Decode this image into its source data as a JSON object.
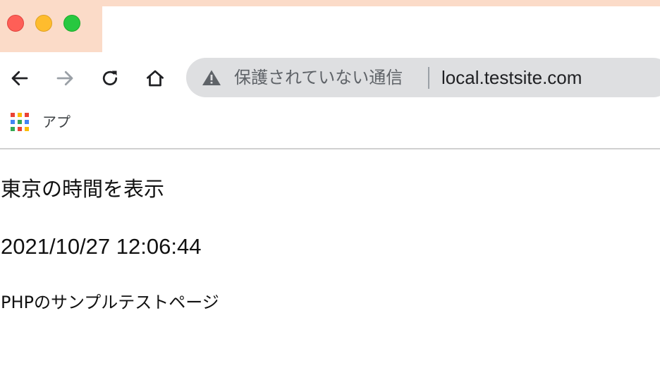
{
  "window": {
    "controls": [
      "close",
      "minimize",
      "zoom"
    ]
  },
  "toolbar": {
    "back_icon": "arrow-left-icon",
    "forward_icon": "arrow-right-icon",
    "reload_icon": "reload-icon",
    "home_icon": "home-icon",
    "security_icon": "warning-triangle-icon",
    "security_label": "保護されていない通信",
    "url": "local.testsite.com"
  },
  "bookmarks": {
    "apps_icon": "apps-grid-icon",
    "apps_label": "アプ",
    "apps_colors": [
      "#ea4335",
      "#fbbc05",
      "#ea4335",
      "#4285f4",
      "#34a853",
      "#4285f4",
      "#34a853",
      "#ea4335",
      "#fbbc05"
    ]
  },
  "page": {
    "heading": "東京の時間を表示",
    "datetime": "2021/10/27 12:06:44",
    "caption": "PHPのサンプルテストページ"
  },
  "colors": {
    "tab_accent": "#fbdbc8",
    "omnibox_bg": "#dedfe1"
  }
}
